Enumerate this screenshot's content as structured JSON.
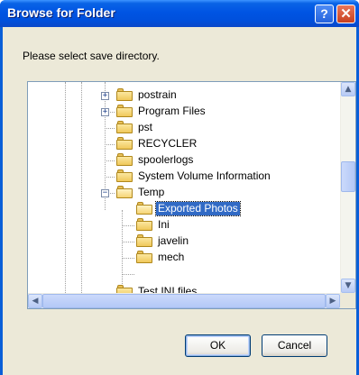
{
  "window": {
    "title": "Browse for Folder",
    "help_glyph": "?",
    "close_glyph": "✕"
  },
  "prompt": "Please select save directory.",
  "tree": {
    "items": [
      {
        "label": "postrain",
        "expander": "+",
        "state": "collapsed"
      },
      {
        "label": "Program Files",
        "expander": "+",
        "state": "collapsed"
      },
      {
        "label": "pst",
        "expander": "",
        "state": "leaf"
      },
      {
        "label": "RECYCLER",
        "expander": "",
        "state": "leaf"
      },
      {
        "label": "spoolerlogs",
        "expander": "",
        "state": "leaf"
      },
      {
        "label": "System Volume Information",
        "expander": "",
        "state": "leaf"
      },
      {
        "label": "Temp",
        "expander": "−",
        "state": "expanded"
      },
      {
        "label": "Exported Photos",
        "expander": "",
        "state": "selected"
      },
      {
        "label": "Ini",
        "expander": "",
        "state": "leaf"
      },
      {
        "label": "javelin",
        "expander": "",
        "state": "leaf"
      },
      {
        "label": "mech",
        "expander": "",
        "state": "leaf"
      },
      {
        "label": "Test INI files",
        "expander": "",
        "state": "partial"
      }
    ],
    "scroll_up_glyph": "▲",
    "scroll_down_glyph": "▼",
    "scroll_left_glyph": "◀",
    "scroll_right_glyph": "▶"
  },
  "buttons": {
    "ok": "OK",
    "cancel": "Cancel"
  },
  "colors": {
    "selection": "#316ac5",
    "titlebar": "#0054e3",
    "dialog_bg": "#ece9d8"
  }
}
